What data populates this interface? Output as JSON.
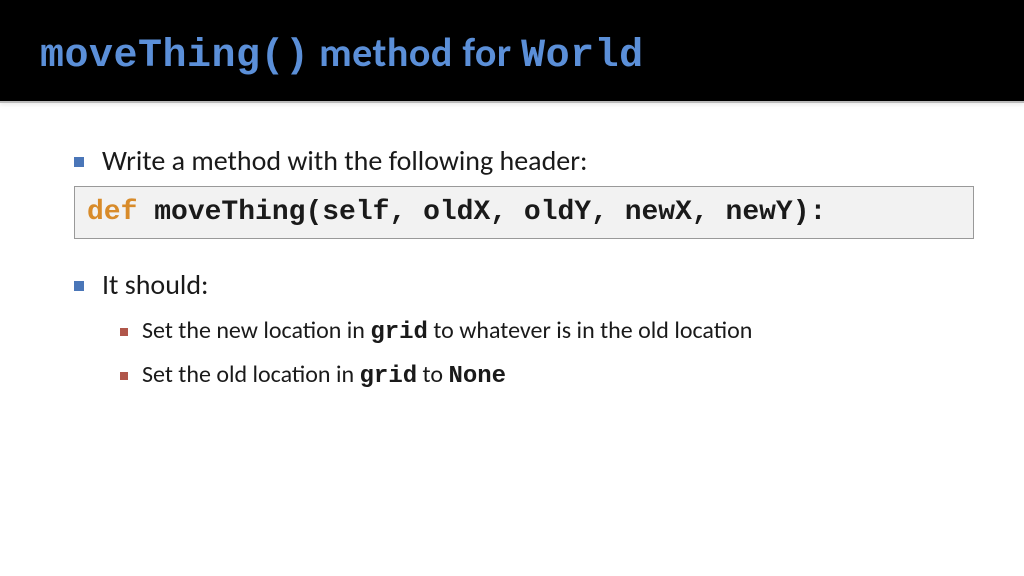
{
  "title": {
    "code1": "moveThing()",
    "mid": " method for ",
    "code2": "World"
  },
  "bullets": {
    "b1": "Write a method with the following header:",
    "code": {
      "keyword": "def",
      "rest": " moveThing(self, oldX, oldY, newX, newY):"
    },
    "b2": "It should:",
    "sub": {
      "s1a": "Set the new location in ",
      "s1b": "grid",
      "s1c": " to whatever is in the old location",
      "s2a": "Set the old location in ",
      "s2b": "grid",
      "s2c": " to ",
      "s2d": "None"
    }
  }
}
